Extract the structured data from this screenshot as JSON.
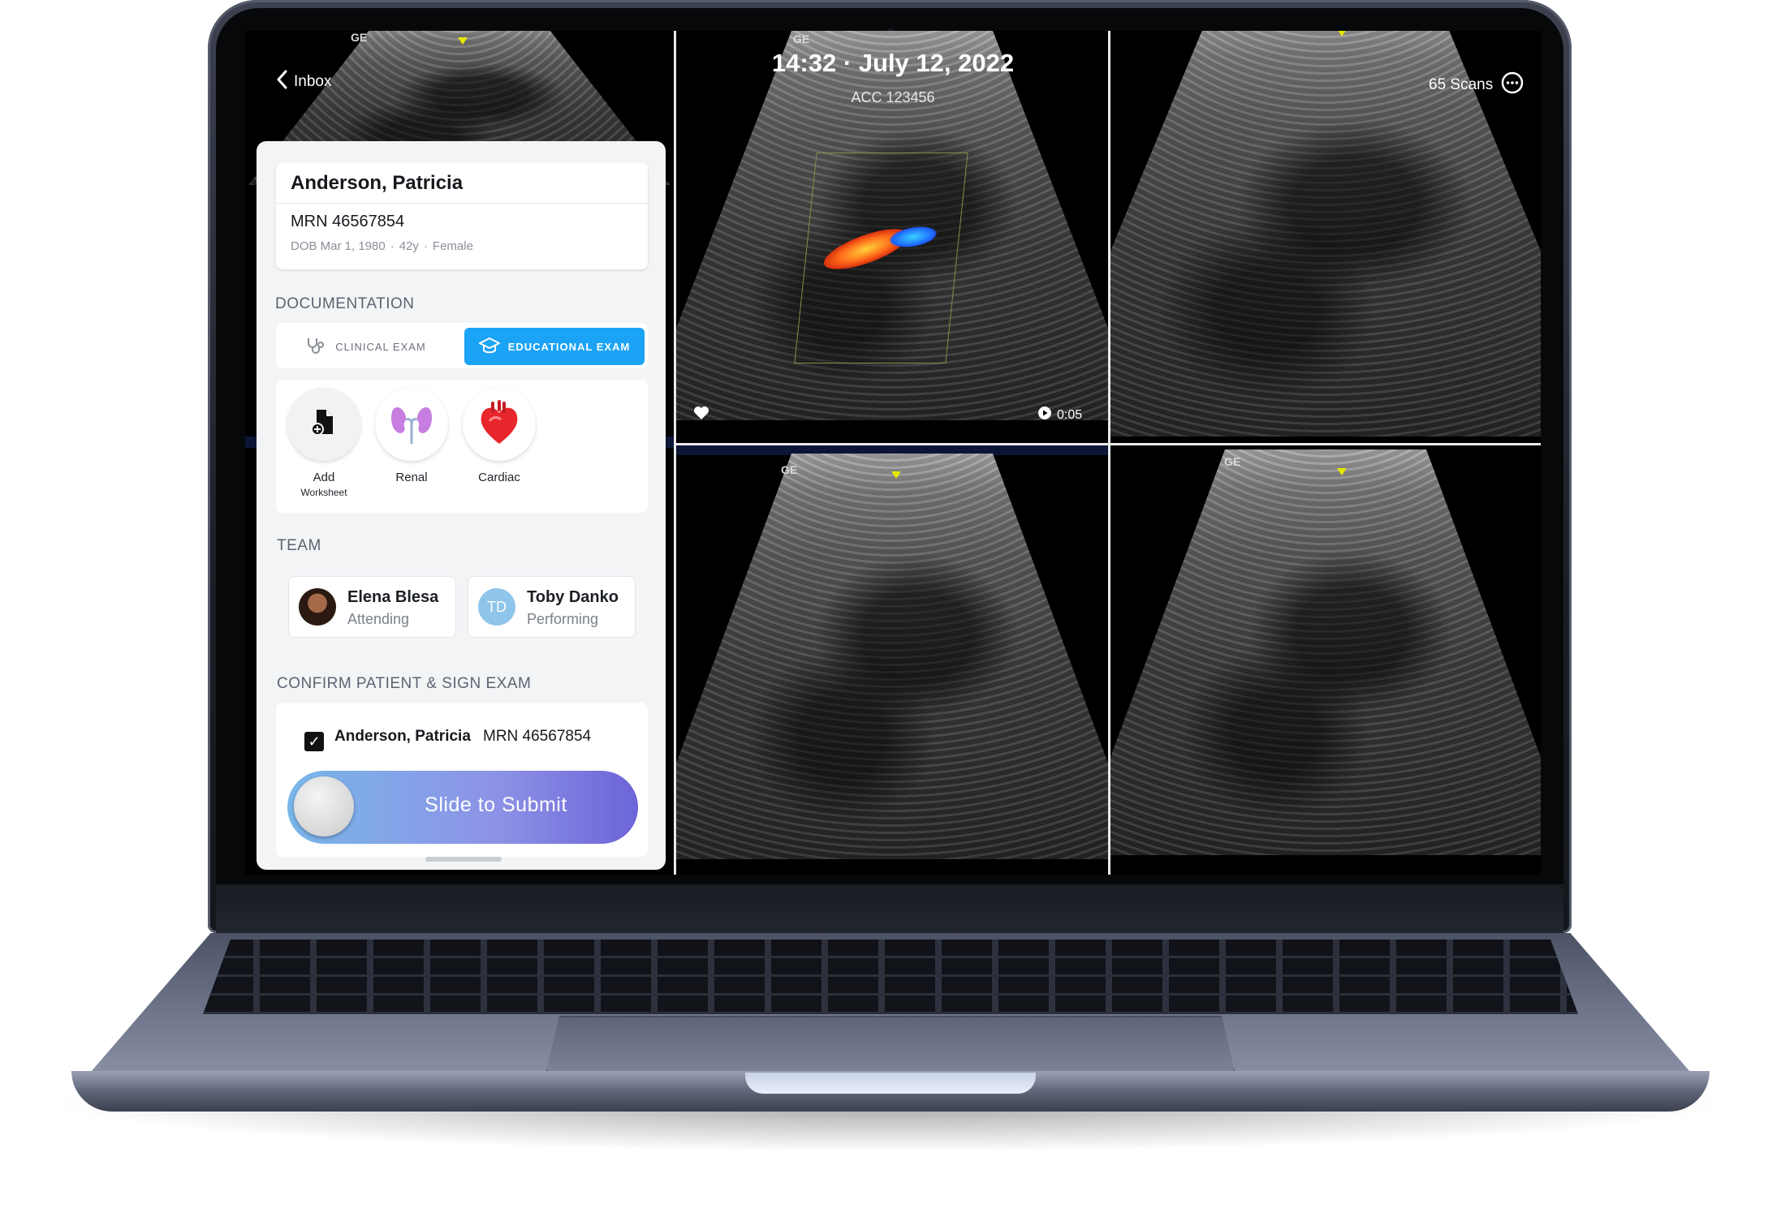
{
  "top_bar": {
    "back_label": "Inbox",
    "time": "14:32",
    "date": "July 12, 2022",
    "accession": "ACC 123456",
    "scan_count": "65 Scans"
  },
  "patient": {
    "name": "Anderson, Patricia",
    "mrn": "MRN 46567854",
    "dob": "DOB Mar 1, 1980",
    "age": "42y",
    "sex": "Female"
  },
  "documentation": {
    "title": "DOCUMENTATION",
    "tabs": [
      {
        "label": "CLINICAL EXAM",
        "active": false
      },
      {
        "label": "EDUCATIONAL EXAM",
        "active": true
      }
    ],
    "worksheets": [
      {
        "label": "Add",
        "sublabel": "Worksheet",
        "icon": "add-worksheet-icon"
      },
      {
        "label": "Renal",
        "icon": "kidney-icon"
      },
      {
        "label": "Cardiac",
        "icon": "heart-icon"
      }
    ]
  },
  "team": {
    "title": "TEAM",
    "members": [
      {
        "name": "Elena Blesa",
        "role": "Attending"
      },
      {
        "name": "Toby Danko",
        "role": "Performing",
        "initials": "TD"
      }
    ]
  },
  "confirm": {
    "title": "CONFIRM PATIENT & SIGN EXAM",
    "checked": true,
    "patient_name": "Anderson, Patricia",
    "mrn": "MRN 46567854",
    "slide_label": "Slide to Submit"
  },
  "clip": {
    "duration": "0:05"
  },
  "colors": {
    "accent": "#1ba3f5",
    "slide_start": "#79b7ea",
    "slide_end": "#6c64d8",
    "doppler_red": "#ff4a1a",
    "doppler_blue": "#1b5cff"
  }
}
